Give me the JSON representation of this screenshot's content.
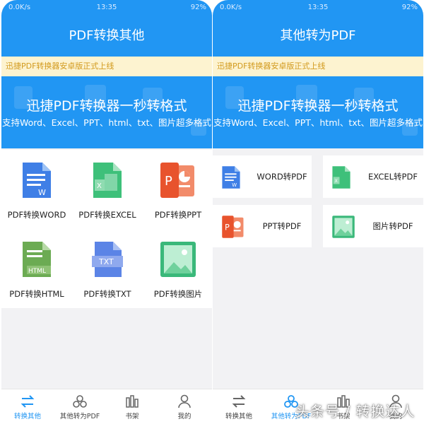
{
  "colors": {
    "primary": "#2196f3",
    "notice_bg": "#fdf3d0",
    "notice_text": "#d29a1d",
    "active_tab": "#2196f3"
  },
  "status": {
    "left": "0.0K/s",
    "time": "13:35",
    "right": "92%"
  },
  "left": {
    "title": "PDF转换其他",
    "notice": "迅捷PDF转换器安卓版正式上线",
    "banner": {
      "title": "迅捷PDF转换器一秒转格式",
      "subtitle": "支持Word、Excel、PPT、html、txt、图片超多格式"
    },
    "items": [
      {
        "label": "PDF转换WORD",
        "icon": "word-doc-icon"
      },
      {
        "label": "PDF转换EXCEL",
        "icon": "excel-doc-icon"
      },
      {
        "label": "PDF转换PPT",
        "icon": "ppt-doc-icon"
      },
      {
        "label": "PDF转换HTML",
        "icon": "html-doc-icon"
      },
      {
        "label": "PDF转换TXT",
        "icon": "txt-doc-icon"
      },
      {
        "label": "PDF转换图片",
        "icon": "image-doc-icon"
      }
    ],
    "tabs": [
      {
        "label": "转换其他",
        "icon": "convert-arrows-icon"
      },
      {
        "label": "其他转为PDF",
        "icon": "recycle-icon"
      },
      {
        "label": "书架",
        "icon": "bookshelf-icon"
      },
      {
        "label": "我的",
        "icon": "user-icon"
      }
    ]
  },
  "right": {
    "title": "其他转为PDF",
    "notice": "迅捷PDF转换器安卓版正式上线",
    "banner": {
      "title": "迅捷PDF转换器一秒转格式",
      "subtitle": "支持Word、Excel、PPT、html、txt、图片超多格式"
    },
    "items": [
      {
        "label": "WORD转PDF",
        "icon": "word-doc-icon"
      },
      {
        "label": "EXCEL转PDF",
        "icon": "excel-doc-icon"
      },
      {
        "label": "PPT转PDF",
        "icon": "ppt-doc-icon"
      },
      {
        "label": "图片转PDF",
        "icon": "image-doc-icon"
      }
    ],
    "tabs": [
      {
        "label": "转换其他",
        "icon": "convert-arrows-icon"
      },
      {
        "label": "其他转为PDF",
        "icon": "recycle-icon"
      },
      {
        "label": "书架",
        "icon": "bookshelf-icon"
      },
      {
        "label": "我的",
        "icon": "user-icon"
      }
    ]
  },
  "watermark": "头条号 / 转换达人"
}
